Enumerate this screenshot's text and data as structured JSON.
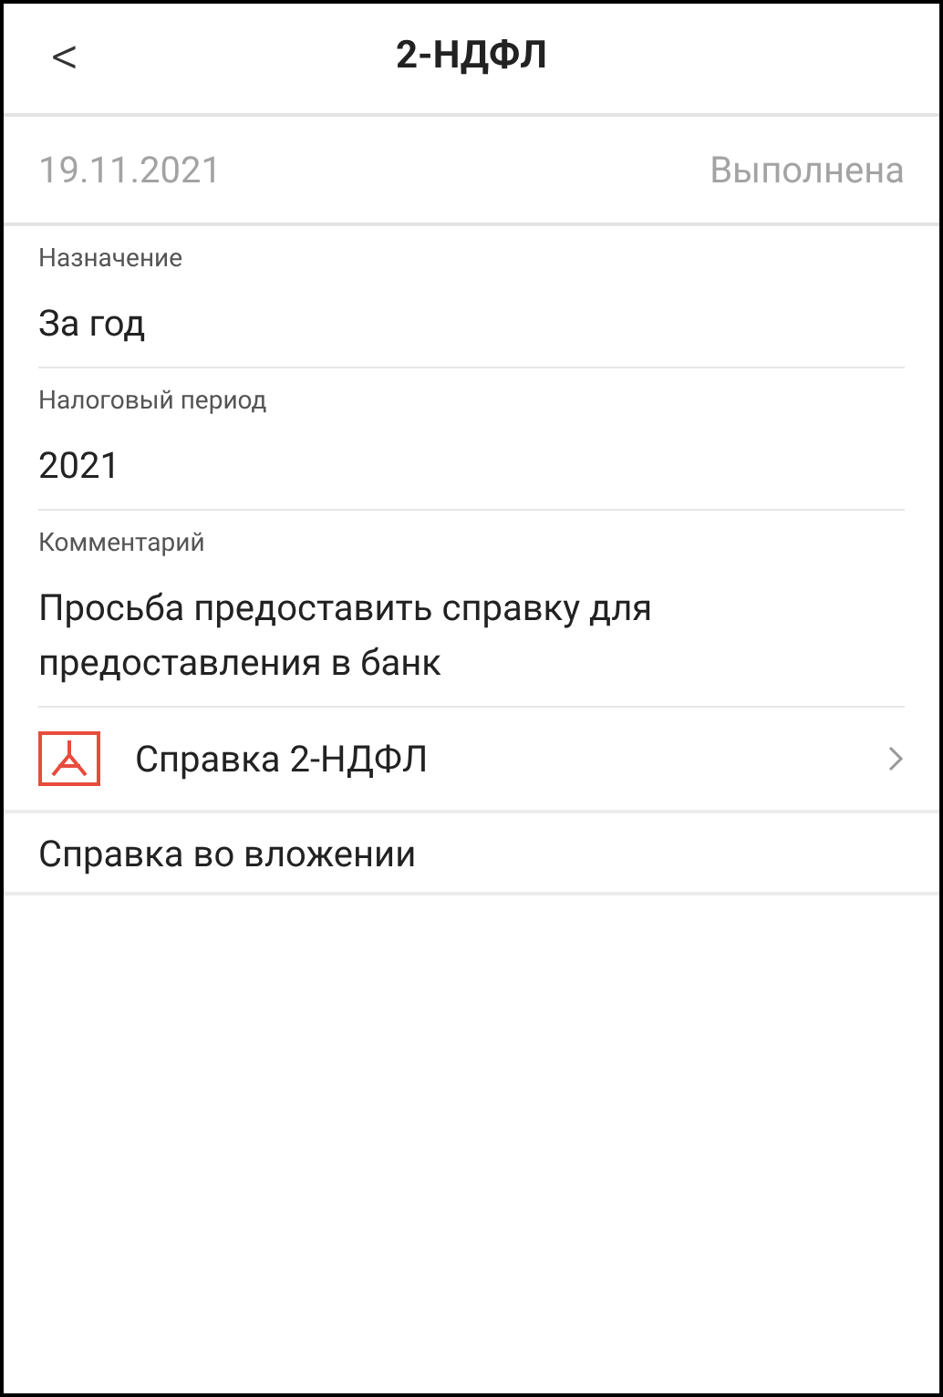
{
  "header": {
    "back": "<",
    "title": "2-НДФЛ"
  },
  "summary": {
    "date": "19.11.2021",
    "status": "Выполнена"
  },
  "fields": [
    {
      "label": "Назначение",
      "value": "За год"
    },
    {
      "label": "Налоговый период",
      "value": "2021"
    },
    {
      "label": "Комментарий",
      "value": "Просьба предоставить справку для предоставления в банк"
    }
  ],
  "attachment": {
    "name": "Справка 2-НДФЛ"
  },
  "note": "Справка во вложении"
}
